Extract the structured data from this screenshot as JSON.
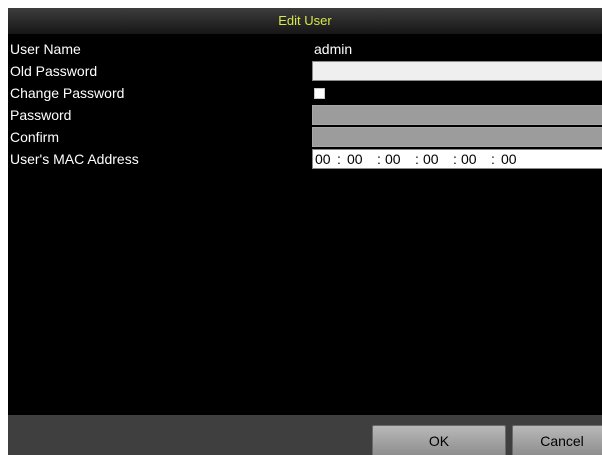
{
  "window": {
    "title": "Edit User"
  },
  "form": {
    "user_name_label": "User Name",
    "user_name_value": "admin",
    "old_password_label": "Old Password",
    "old_password_value": "",
    "change_password_label": "Change Password",
    "change_password_checked": false,
    "password_label": "Password",
    "password_value": "",
    "confirm_label": "Confirm",
    "confirm_value": "",
    "mac_label": "User's MAC Address",
    "mac_octets": [
      "00",
      "00",
      "00",
      "00",
      "00",
      "00"
    ],
    "mac_separator": ":"
  },
  "footer": {
    "ok_label": "OK",
    "cancel_label": "Cancel"
  },
  "colors": {
    "title_text": "#d6e84a",
    "background": "#000000",
    "footer_bg": "#3f3f3f",
    "disabled_field": "#9c9c9c"
  }
}
